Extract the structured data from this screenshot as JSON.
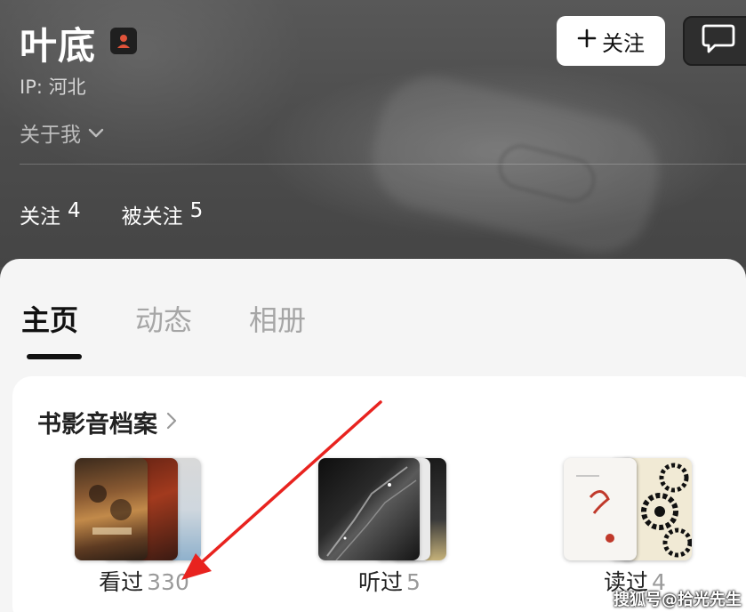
{
  "profile": {
    "name": "叶底",
    "ip_label": "IP: 河北",
    "about_label": "关于我",
    "following_label": "关注",
    "following_count": "4",
    "followers_label": "被关注",
    "followers_count": "5",
    "follow_button": "关注"
  },
  "tabs": [
    {
      "label": "主页",
      "active": true
    },
    {
      "label": "动态",
      "active": false
    },
    {
      "label": "相册",
      "active": false
    }
  ],
  "archive": {
    "title": "书影音档案",
    "items": [
      {
        "label": "看过",
        "count": "330"
      },
      {
        "label": "听过",
        "count": "5"
      },
      {
        "label": "读过",
        "count": "4"
      }
    ]
  },
  "watermark": "搜狐号@拾光先生",
  "colors": {
    "header_bg": "#4a4a4a",
    "content_bg": "#f5f5f5",
    "arrow": "#e8231f",
    "badge_accent": "#e0533a"
  },
  "icons": {
    "badge": "person-badge-icon",
    "about_toggle": "chevron-down-icon",
    "follow": "plus-icon",
    "message": "chat-bubble-icon",
    "archive_more": "chevron-right-icon"
  }
}
